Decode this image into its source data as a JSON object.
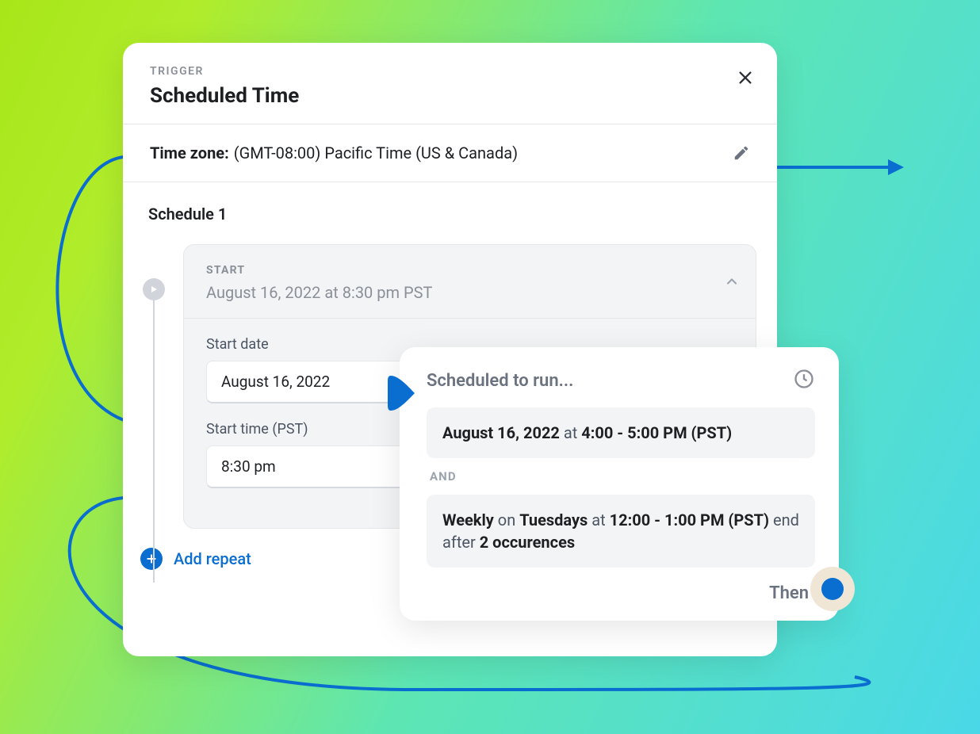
{
  "header": {
    "eyebrow": "TRIGGER",
    "title": "Scheduled Time"
  },
  "timezone": {
    "label": "Time zone:",
    "value": "(GMT-08:00) Pacific Time (US & Canada)"
  },
  "schedule": {
    "title": "Schedule 1",
    "start": {
      "label": "START",
      "summary": "August 16, 2022 at 8:30 pm PST",
      "start_date_label": "Start date",
      "start_date_value": "August 16, 2022",
      "start_time_label": "Start time (PST)",
      "start_time_value": "8:30 pm"
    },
    "add_repeat_label": "Add repeat"
  },
  "popover": {
    "title": "Scheduled to run...",
    "rule1": {
      "date": "August 16, 2022",
      "at": " at ",
      "time": "4:00 - 5:00 PM (PST)"
    },
    "and": "AND",
    "rule2": {
      "freq": "Weekly",
      "on_word": " on ",
      "day": "Tuesdays",
      "at_word": " at ",
      "time": "12:00 - 1:00 PM (PST)",
      "end_word": " end after ",
      "count": "2 occurences"
    },
    "then": "Then"
  }
}
